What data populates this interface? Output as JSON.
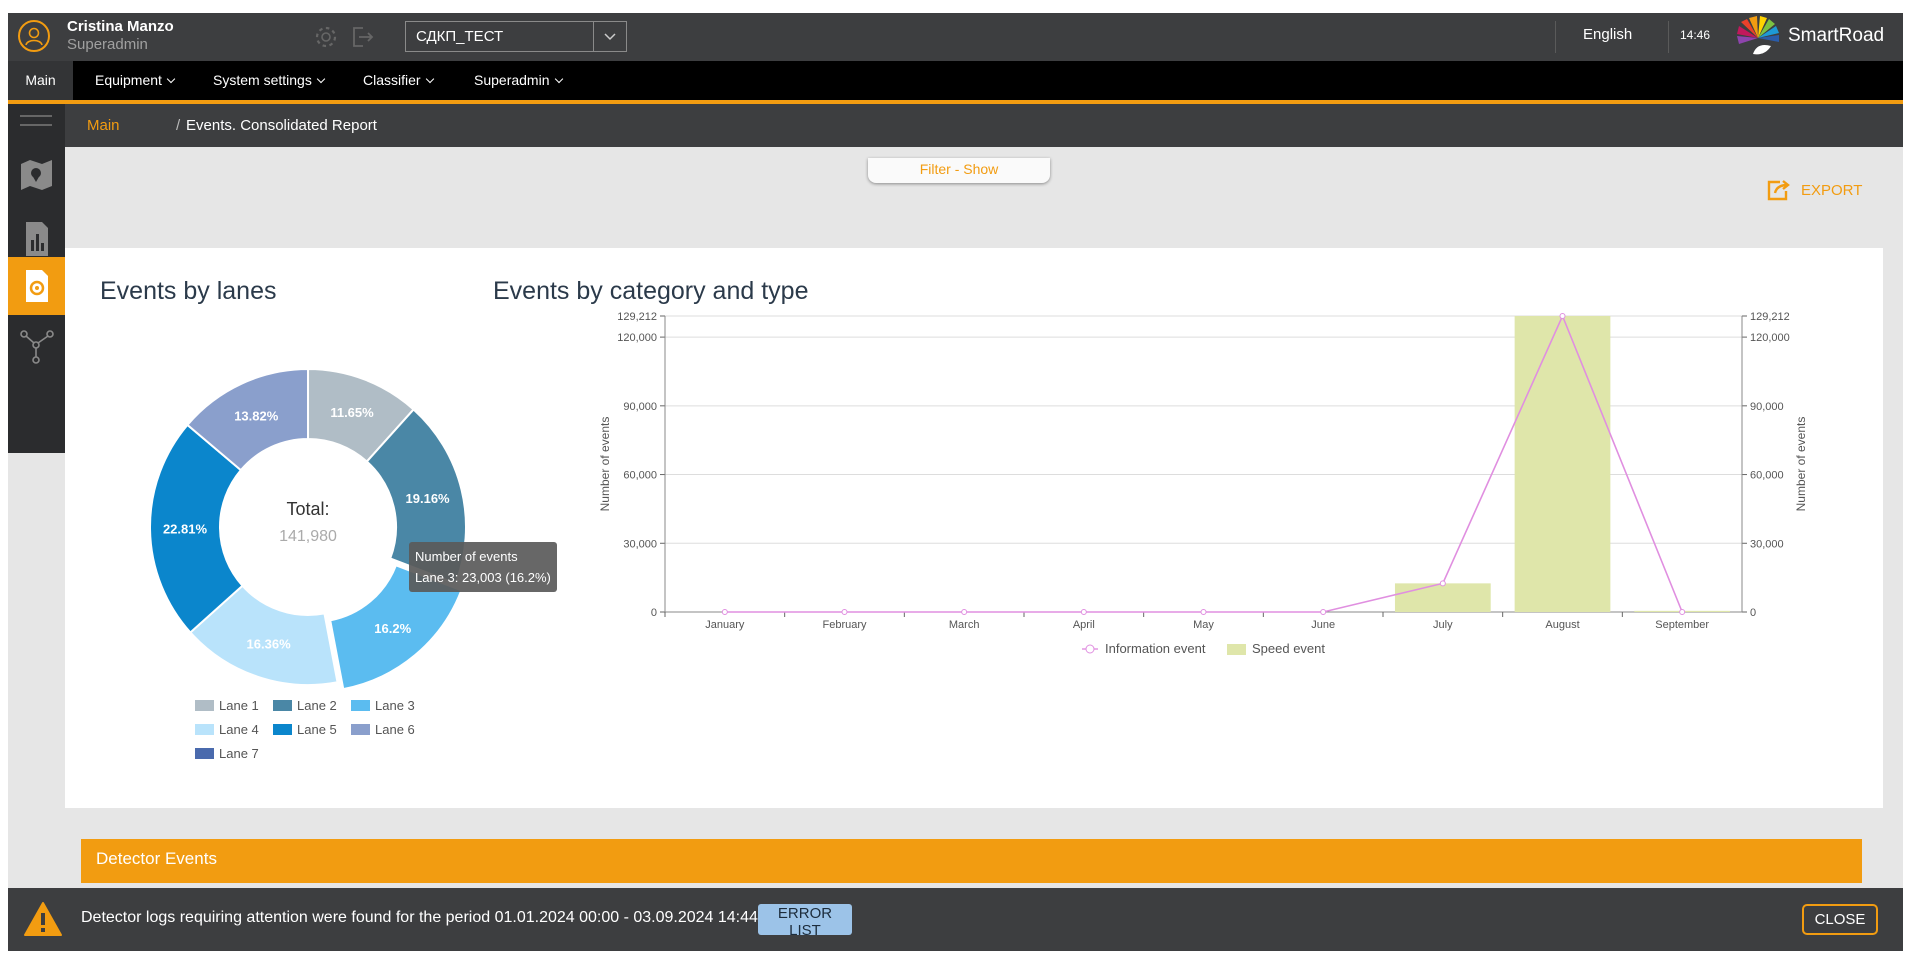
{
  "header": {
    "user_name": "Cristina Manzo",
    "user_role": "Superadmin",
    "domain_selected": "СДКП_ТЕСТ",
    "language": "English",
    "time": "14:46",
    "brand": "SmartRoad"
  },
  "nav": {
    "items": [
      {
        "label": "Main",
        "dropdown": false
      },
      {
        "label": "Equipment",
        "dropdown": true
      },
      {
        "label": "System settings",
        "dropdown": true
      },
      {
        "label": "Classifier",
        "dropdown": true
      },
      {
        "label": "Superadmin",
        "dropdown": true
      }
    ]
  },
  "breadcrumb": {
    "root": "Main",
    "separator": "/",
    "current": "Events. Consolidated Report"
  },
  "filter_tab": "Filter - Show",
  "export_label": "EXPORT",
  "lanes_panel": {
    "title": "Events by lanes",
    "total_label": "Total:",
    "total_value": "141,980",
    "tooltip_title": "Number of events",
    "tooltip_value": "Lane 3: 23,003 (16.2%)"
  },
  "category_panel": {
    "title": "Events by category and type"
  },
  "chart_data": [
    {
      "type": "pie",
      "subtype": "donut",
      "title": "Events by lanes",
      "total": 141980,
      "slices": [
        {
          "name": "Lane 1",
          "percent": 11.65,
          "label": "11.65%",
          "color": "#b0bdc6"
        },
        {
          "name": "Lane 2",
          "percent": 19.16,
          "label": "19.16%",
          "color": "#4a87a6"
        },
        {
          "name": "Lane 3",
          "percent": 16.2,
          "label": "16.2%",
          "color": "#5bbcf0",
          "hovered": true
        },
        {
          "name": "Lane 4",
          "percent": 16.36,
          "label": "16.36%",
          "color": "#b9e3fb"
        },
        {
          "name": "Lane 5",
          "percent": 22.81,
          "label": "22.81%",
          "color": "#0b86cc"
        },
        {
          "name": "Lane 6",
          "percent": 13.82,
          "label": "13.82%",
          "color": "#8a9fcc"
        }
      ],
      "legend": [
        {
          "name": "Lane 1",
          "color": "#b0bdc6"
        },
        {
          "name": "Lane 2",
          "color": "#4a87a6"
        },
        {
          "name": "Lane 3",
          "color": "#5bbcf0"
        },
        {
          "name": "Lane 4",
          "color": "#b9e3fb"
        },
        {
          "name": "Lane 5",
          "color": "#0b86cc"
        },
        {
          "name": "Lane 6",
          "color": "#8a9fcc"
        },
        {
          "name": "Lane 7",
          "color": "#4a6aad"
        }
      ]
    },
    {
      "type": "bar",
      "title": "Events by category and type",
      "categories": [
        "January",
        "February",
        "March",
        "April",
        "May",
        "June",
        "July",
        "August",
        "September"
      ],
      "ylabel": "Number of events",
      "y2label": "Number of events",
      "ylim": [
        0,
        129212
      ],
      "yticks": [
        0,
        30000,
        60000,
        90000,
        120000,
        129212
      ],
      "ytick_labels": [
        "0",
        "30,000",
        "60,000",
        "90,000",
        "120,000",
        "129,212"
      ],
      "series": [
        {
          "name": "Information event",
          "type": "line",
          "color": "#e08fe0",
          "values": [
            0,
            0,
            0,
            0,
            0,
            0,
            12500,
            129212,
            0
          ]
        },
        {
          "name": "Speed event",
          "type": "bar",
          "color": "#dfe6aa",
          "values": [
            0,
            0,
            0,
            0,
            0,
            0,
            12500,
            129212,
            500
          ]
        }
      ],
      "legend_position": "bottom",
      "grid": true
    }
  ],
  "detector_events": {
    "title": "Detector Events"
  },
  "alert": {
    "message": "Detector logs requiring attention were found for the period 01.01.2024 00:00 - 03.09.2024 14:44",
    "error_list_label": "ERROR LIST",
    "close_label": "CLOSE"
  },
  "colors": {
    "accent": "#f29c11",
    "header_bg": "#3d3e40",
    "nav_bg": "#000000",
    "sidebar_bg": "#2b2c2e"
  }
}
